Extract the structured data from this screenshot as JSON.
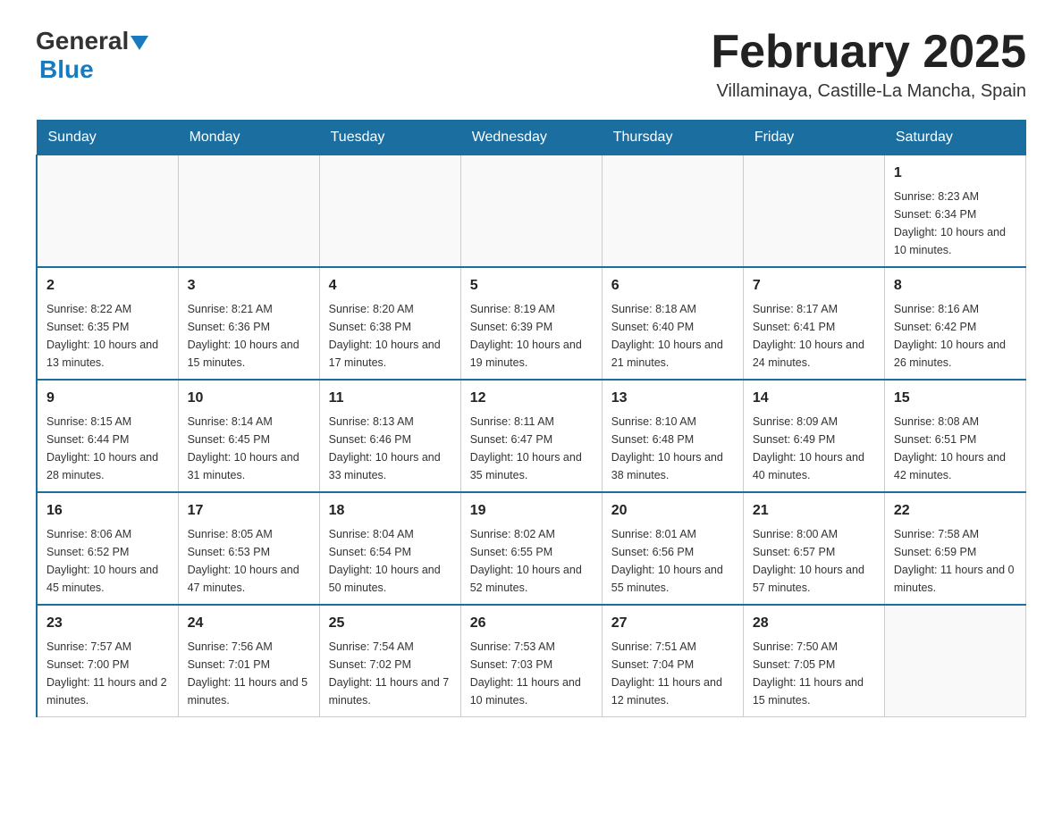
{
  "header": {
    "logo_general": "General",
    "logo_blue": "Blue",
    "title": "February 2025",
    "subtitle": "Villaminaya, Castille-La Mancha, Spain"
  },
  "weekdays": [
    "Sunday",
    "Monday",
    "Tuesday",
    "Wednesday",
    "Thursday",
    "Friday",
    "Saturday"
  ],
  "weeks": [
    [
      {
        "day": "",
        "info": ""
      },
      {
        "day": "",
        "info": ""
      },
      {
        "day": "",
        "info": ""
      },
      {
        "day": "",
        "info": ""
      },
      {
        "day": "",
        "info": ""
      },
      {
        "day": "",
        "info": ""
      },
      {
        "day": "1",
        "info": "Sunrise: 8:23 AM\nSunset: 6:34 PM\nDaylight: 10 hours and 10 minutes."
      }
    ],
    [
      {
        "day": "2",
        "info": "Sunrise: 8:22 AM\nSunset: 6:35 PM\nDaylight: 10 hours and 13 minutes."
      },
      {
        "day": "3",
        "info": "Sunrise: 8:21 AM\nSunset: 6:36 PM\nDaylight: 10 hours and 15 minutes."
      },
      {
        "day": "4",
        "info": "Sunrise: 8:20 AM\nSunset: 6:38 PM\nDaylight: 10 hours and 17 minutes."
      },
      {
        "day": "5",
        "info": "Sunrise: 8:19 AM\nSunset: 6:39 PM\nDaylight: 10 hours and 19 minutes."
      },
      {
        "day": "6",
        "info": "Sunrise: 8:18 AM\nSunset: 6:40 PM\nDaylight: 10 hours and 21 minutes."
      },
      {
        "day": "7",
        "info": "Sunrise: 8:17 AM\nSunset: 6:41 PM\nDaylight: 10 hours and 24 minutes."
      },
      {
        "day": "8",
        "info": "Sunrise: 8:16 AM\nSunset: 6:42 PM\nDaylight: 10 hours and 26 minutes."
      }
    ],
    [
      {
        "day": "9",
        "info": "Sunrise: 8:15 AM\nSunset: 6:44 PM\nDaylight: 10 hours and 28 minutes."
      },
      {
        "day": "10",
        "info": "Sunrise: 8:14 AM\nSunset: 6:45 PM\nDaylight: 10 hours and 31 minutes."
      },
      {
        "day": "11",
        "info": "Sunrise: 8:13 AM\nSunset: 6:46 PM\nDaylight: 10 hours and 33 minutes."
      },
      {
        "day": "12",
        "info": "Sunrise: 8:11 AM\nSunset: 6:47 PM\nDaylight: 10 hours and 35 minutes."
      },
      {
        "day": "13",
        "info": "Sunrise: 8:10 AM\nSunset: 6:48 PM\nDaylight: 10 hours and 38 minutes."
      },
      {
        "day": "14",
        "info": "Sunrise: 8:09 AM\nSunset: 6:49 PM\nDaylight: 10 hours and 40 minutes."
      },
      {
        "day": "15",
        "info": "Sunrise: 8:08 AM\nSunset: 6:51 PM\nDaylight: 10 hours and 42 minutes."
      }
    ],
    [
      {
        "day": "16",
        "info": "Sunrise: 8:06 AM\nSunset: 6:52 PM\nDaylight: 10 hours and 45 minutes."
      },
      {
        "day": "17",
        "info": "Sunrise: 8:05 AM\nSunset: 6:53 PM\nDaylight: 10 hours and 47 minutes."
      },
      {
        "day": "18",
        "info": "Sunrise: 8:04 AM\nSunset: 6:54 PM\nDaylight: 10 hours and 50 minutes."
      },
      {
        "day": "19",
        "info": "Sunrise: 8:02 AM\nSunset: 6:55 PM\nDaylight: 10 hours and 52 minutes."
      },
      {
        "day": "20",
        "info": "Sunrise: 8:01 AM\nSunset: 6:56 PM\nDaylight: 10 hours and 55 minutes."
      },
      {
        "day": "21",
        "info": "Sunrise: 8:00 AM\nSunset: 6:57 PM\nDaylight: 10 hours and 57 minutes."
      },
      {
        "day": "22",
        "info": "Sunrise: 7:58 AM\nSunset: 6:59 PM\nDaylight: 11 hours and 0 minutes."
      }
    ],
    [
      {
        "day": "23",
        "info": "Sunrise: 7:57 AM\nSunset: 7:00 PM\nDaylight: 11 hours and 2 minutes."
      },
      {
        "day": "24",
        "info": "Sunrise: 7:56 AM\nSunset: 7:01 PM\nDaylight: 11 hours and 5 minutes."
      },
      {
        "day": "25",
        "info": "Sunrise: 7:54 AM\nSunset: 7:02 PM\nDaylight: 11 hours and 7 minutes."
      },
      {
        "day": "26",
        "info": "Sunrise: 7:53 AM\nSunset: 7:03 PM\nDaylight: 11 hours and 10 minutes."
      },
      {
        "day": "27",
        "info": "Sunrise: 7:51 AM\nSunset: 7:04 PM\nDaylight: 11 hours and 12 minutes."
      },
      {
        "day": "28",
        "info": "Sunrise: 7:50 AM\nSunset: 7:05 PM\nDaylight: 11 hours and 15 minutes."
      },
      {
        "day": "",
        "info": ""
      }
    ]
  ]
}
